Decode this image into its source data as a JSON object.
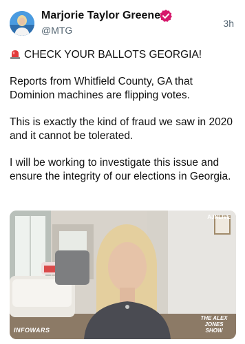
{
  "author": {
    "name": "Marjorie Taylor Greene",
    "handle": "@MTG",
    "verified": true,
    "avatar_icon": "profile-photo-avatar",
    "verified_icon": "verified-badge-icon",
    "verified_color": "#d6176b"
  },
  "timestamp": "3h",
  "post": {
    "alarm_icon": "rotating-light-icon",
    "headline": "CHECK YOUR BALLOTS GEORGIA!",
    "paragraphs": [
      "Reports from Whitfield County, GA that Dominion machines are flipping votes.",
      "This is exactly the kind of fraud we saw in 2020 and it cannot be tolerated.",
      "I will be working to investigate this issue and ensure the integrity of our elections in Georgia."
    ]
  },
  "media": {
    "type": "video-still",
    "watermark_top_right": "AJNLIVE",
    "watermark_bottom_left": "INFOWARS",
    "watermark_bottom_right": "THE ALEX JONES SHOW"
  }
}
